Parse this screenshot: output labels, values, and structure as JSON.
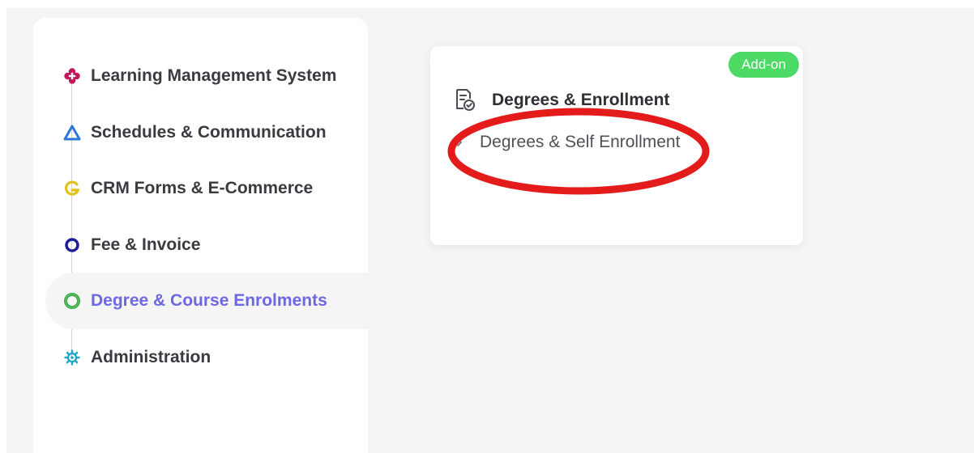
{
  "sidebar": {
    "items": [
      {
        "label": "Learning Management System",
        "icon": "lms-flower-icon",
        "color": "#c2185b"
      },
      {
        "label": "Schedules & Communication",
        "icon": "triangle-icon",
        "color": "#2b79d6"
      },
      {
        "label": "CRM Forms & E-Commerce",
        "icon": "crm-g-icon",
        "color": "#e0c21a"
      },
      {
        "label": "Fee & Invoice",
        "icon": "ring-icon",
        "color": "#1e1e9a"
      },
      {
        "label": "Degree & Course Enrolments",
        "icon": "green-ring-icon",
        "color": "#3fa84a"
      },
      {
        "label": "Administration",
        "icon": "gear-icon",
        "color": "#1aa6c7"
      }
    ],
    "active_index": 4,
    "active_color": "#6d68e0"
  },
  "card": {
    "badge": "Add-on",
    "badge_color": "#4cd964",
    "title": "Degrees & Enrollment",
    "link_label": "Degrees & Self Enrollment"
  },
  "annotation": {
    "shape": "ellipse",
    "color": "#e41b1b"
  }
}
